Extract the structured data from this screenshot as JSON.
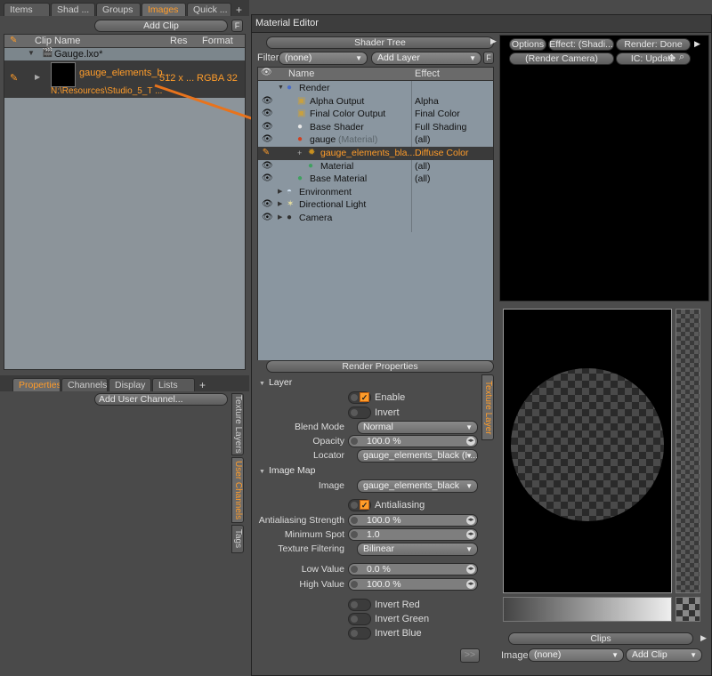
{
  "left_tabs": {
    "items": [
      "Items",
      "Shad ...",
      "Groups",
      "Images",
      "Quick ..."
    ],
    "active": 3,
    "add": "+"
  },
  "clips": {
    "add_clip": "Add Clip",
    "f_button": "F",
    "col_clip": "Clip Name",
    "col_res": "Res",
    "col_format": "Format",
    "scene": "Gauge.lxo*",
    "clip_name": "gauge_elements_b...",
    "clip_path": "N:\\Resources\\Studio_5_T ...",
    "clip_res": "512 x ...",
    "clip_format": "RGBA 32"
  },
  "bottom_tabs": {
    "items": [
      "Properties",
      "Channels",
      "Display",
      "Lists"
    ],
    "active": 0,
    "add": "+"
  },
  "user_channel": {
    "add": "Add User Channel..."
  },
  "side_vtabs": [
    "Texture Layers",
    "User Channels",
    "Tags"
  ],
  "editor": {
    "title": "Material Editor"
  },
  "shader_tree": {
    "title": "Shader Tree",
    "filter_label": "Filter",
    "filter_value": "(none)",
    "add_layer": "Add Layer",
    "col_name": "Name",
    "col_effect": "Effect",
    "rows": [
      {
        "name": "Render",
        "effect": "",
        "indent": 1,
        "eye": false,
        "icon": "render"
      },
      {
        "name": "Alpha Output",
        "effect": "Alpha",
        "indent": 2,
        "eye": true,
        "icon": "output"
      },
      {
        "name": "Final Color Output",
        "effect": "Final Color",
        "indent": 2,
        "eye": true,
        "icon": "output"
      },
      {
        "name": "Base Shader",
        "effect": "Full Shading",
        "indent": 2,
        "eye": true,
        "icon": "shader"
      },
      {
        "name": "gauge",
        "suffix": "(Material)",
        "effect": "(all)",
        "indent": 2,
        "eye": true,
        "icon": "mask"
      },
      {
        "name": "gauge_elements_bla...",
        "effect": "Diffuse Color",
        "indent": 3,
        "eye": false,
        "icon": "image",
        "selected": true
      },
      {
        "name": "Material",
        "effect": "(all)",
        "indent": 3,
        "eye": true,
        "icon": "material"
      },
      {
        "name": "Base Material",
        "effect": "(all)",
        "indent": 2,
        "eye": true,
        "icon": "material"
      },
      {
        "name": "Environment",
        "effect": "",
        "indent": 1,
        "eye": false,
        "icon": "env"
      },
      {
        "name": "Directional Light",
        "effect": "",
        "indent": 1,
        "eye": true,
        "icon": "light"
      },
      {
        "name": "Camera",
        "effect": "",
        "indent": 1,
        "eye": true,
        "icon": "camera"
      }
    ]
  },
  "preview": {
    "options": "Options",
    "effect": "Effect: (Shadi...",
    "render": "Render: Done",
    "camera": "(Render Camera)",
    "ic": "IC: Update"
  },
  "props": {
    "title": "Render Properties",
    "layer_section": "Layer",
    "enable": "Enable",
    "invert": "Invert",
    "blend_mode_label": "Blend Mode",
    "blend_mode": "Normal",
    "opacity_label": "Opacity",
    "opacity": "100.0 %",
    "locator_label": "Locator",
    "locator": "gauge_elements_black (I ...",
    "image_map_section": "Image Map",
    "image_label": "Image",
    "image": "gauge_elements_black",
    "antialiasing": "Antialiasing",
    "aa_strength_label": "Antialiasing Strength",
    "aa_strength": "100.0 %",
    "min_spot_label": "Minimum Spot",
    "min_spot": "1.0",
    "tex_filter_label": "Texture Filtering",
    "tex_filter": "Bilinear",
    "low_label": "Low Value",
    "low": "0.0 %",
    "high_label": "High Value",
    "high": "100.0 %",
    "invert_red": "Invert Red",
    "invert_green": "Invert Green",
    "invert_blue": "Invert Blue",
    "more": ">>",
    "vtab": "Texture Layer"
  },
  "clips_panel": {
    "title": "Clips",
    "image_label": "Image",
    "image_value": "(none)",
    "add_clip": "Add Clip"
  },
  "colors": {
    "accent": "#ff9c2a",
    "arrow": "#e8731c",
    "selected_row": "#3a3a3a",
    "tree_bg": "#8a96a0"
  }
}
